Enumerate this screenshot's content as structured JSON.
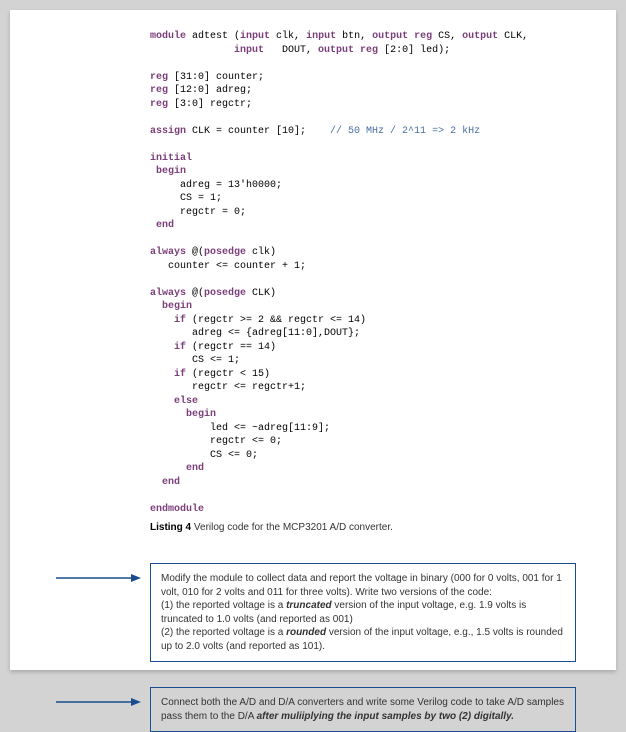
{
  "code": {
    "l1a": "module",
    "l1b": " adtest (",
    "l1c": "input",
    "l1d": " clk, ",
    "l1e": "input",
    "l1f": " btn, ",
    "l1g": "output reg",
    "l1h": " CS, ",
    "l1i": "output",
    "l1j": " CLK,",
    "l2a": "input",
    "l2b": "   DOUT, ",
    "l2c": "output reg",
    "l2d": " [2:0] led);",
    "l3": " ",
    "l4a": "reg",
    "l4b": " [31:0] counter;",
    "l5a": "reg",
    "l5b": " [12:0] adreg;",
    "l6a": "reg",
    "l6b": " [3:0] regctr;",
    "l7": " ",
    "l8a": "assign",
    "l8b": " CLK = counter [10];    ",
    "l8c": "// 50 MHz / 2^11 => 2 kHz",
    "l9": " ",
    "l10": "initial",
    "l11": "begin",
    "l12": "     adreg = 13'h0000;",
    "l13": "     CS = 1;",
    "l14": "     regctr = 0;",
    "l15": "end",
    "l16": " ",
    "l17a": "always",
    "l17b": " @(",
    "l17c": "posedge",
    "l17d": " clk)",
    "l18": "   counter <= counter + 1;",
    "l19": " ",
    "l20a": "always",
    "l20b": " @(",
    "l20c": "posedge",
    "l20d": " CLK)",
    "l21": "begin",
    "l22a": "if",
    "l22b": " (regctr >= 2 && regctr <= 14)",
    "l23": "       adreg <= {adreg[11:0],DOUT};",
    "l24a": "if",
    "l24b": " (regctr == 14)",
    "l25": "       CS <= 1;",
    "l26a": "if",
    "l26b": " (regctr < 15)",
    "l27": "       regctr <= regctr+1;",
    "l28": "else",
    "l29": "begin",
    "l30": "          led <= ~adreg[11:9];",
    "l31": "          regctr <= 0;",
    "l32": "          CS <= 0;",
    "l33": "end",
    "l34": "end",
    "l35": " ",
    "l36": "endmodule"
  },
  "caption": {
    "label": "Listing 4",
    "text": " Verilog code for the MCP3201 A/D converter."
  },
  "task1": {
    "p1": "Modify the module to collect data and report the voltage in binary (000 for 0 volts, 001 for 1 volt, 010 for 2 volts and 011 for three volts).  Write two versions of the code:",
    "p2a": "(1) the reported voltage is a ",
    "p2b": "truncated",
    "p2c": " version of the input voltage, e.g. 1.9 volts is truncated to 1.0 volts (and reported as 001)",
    "p3a": "(2)  the reported voltage is a ",
    "p3b": "rounded",
    "p3c": " version of the input voltage, e.g., 1.5 volts is rounded up to 2.0 volts (and reported as 101)."
  },
  "task2": {
    "p1a": "Connect both the A/D and D/A converters and write some Verilog code to take A/D samples pass them to the D/A ",
    "p1b": "after muliiplying the input samples by two (2) digitally."
  }
}
